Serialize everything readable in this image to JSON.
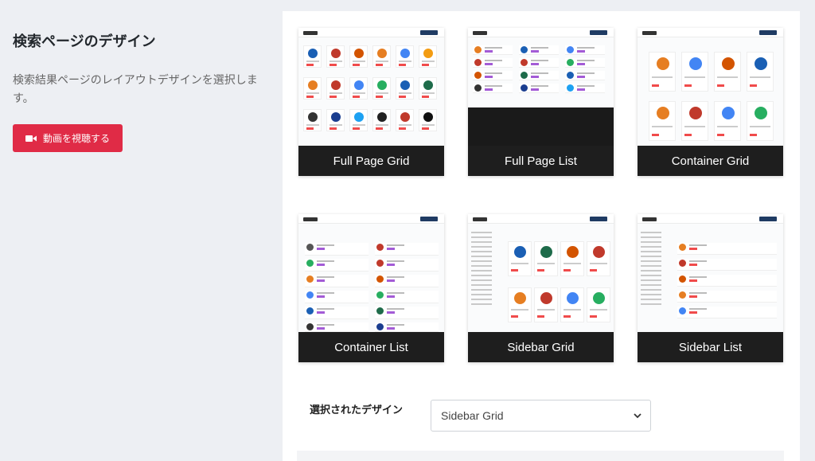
{
  "intro": {
    "title": "検索ページのデザイン",
    "description": "検索結果ページのレイアウトデザインを選択します。",
    "video_button": "動画を視聴する"
  },
  "designs": [
    {
      "label": "Full Page Grid"
    },
    {
      "label": "Full Page List"
    },
    {
      "label": "Container Grid"
    },
    {
      "label": "Container List"
    },
    {
      "label": "Sidebar Grid"
    },
    {
      "label": "Sidebar List"
    }
  ],
  "selection": {
    "label": "選択されたデザイン",
    "value": "Sidebar Grid"
  },
  "colors": {
    "accent": "#e02b46",
    "card_label_bg": "#1e1e1e",
    "page_bg": "#edeff3"
  }
}
